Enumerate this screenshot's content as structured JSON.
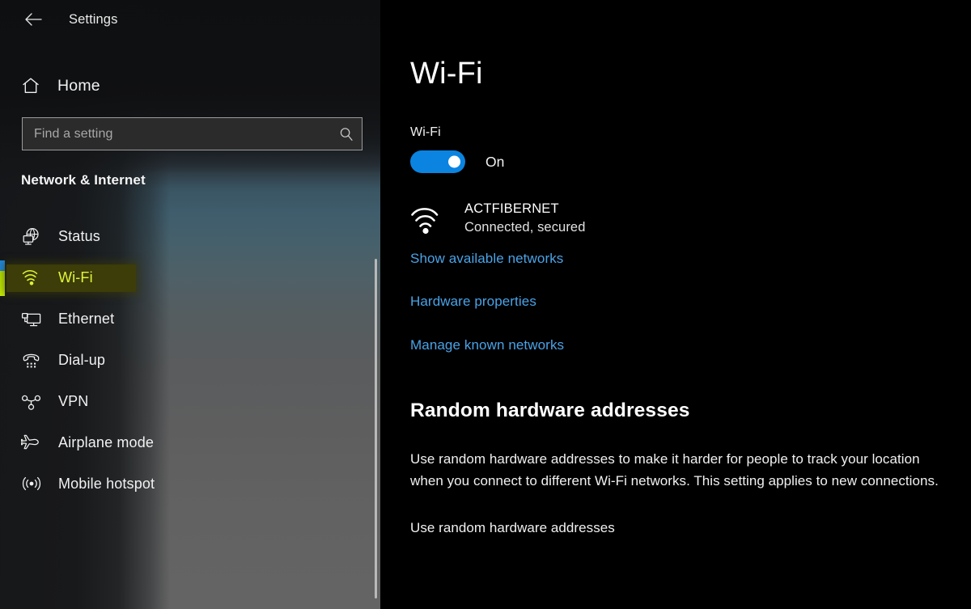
{
  "sidebar": {
    "back_label": "Back",
    "title": "Settings",
    "home": {
      "label": "Home",
      "icon": "home-icon"
    },
    "search": {
      "value": "",
      "placeholder": "Find a setting",
      "icon": "search-icon"
    },
    "category_title": "Network & Internet",
    "items": [
      {
        "label": "Status",
        "icon": "globe-status-icon",
        "selected": false
      },
      {
        "label": "Wi-Fi",
        "icon": "wifi-icon",
        "selected": true
      },
      {
        "label": "Ethernet",
        "icon": "ethernet-icon",
        "selected": false
      },
      {
        "label": "Dial-up",
        "icon": "dialup-phone-icon",
        "selected": false
      },
      {
        "label": "VPN",
        "icon": "vpn-icon",
        "selected": false
      },
      {
        "label": "Airplane mode",
        "icon": "airplane-icon",
        "selected": false
      },
      {
        "label": "Mobile hotspot",
        "icon": "mobile-hotspot-icon",
        "selected": false
      }
    ]
  },
  "main": {
    "page_title": "Wi-Fi",
    "wifi": {
      "label": "Wi-Fi",
      "toggle_state": "On",
      "toggle_on": true,
      "network_name": "ACTFIBERNET",
      "network_status": "Connected, secured",
      "network_icon": "wifi-signal-icon"
    },
    "links": [
      "Show available networks",
      "Hardware properties",
      "Manage known networks"
    ],
    "random_hw": {
      "title": "Random hardware addresses",
      "description": "Use random hardware addresses to make it harder for people to track your location when you connect to different Wi-Fi networks. This setting applies to new connections.",
      "sub_label": "Use random hardware addresses"
    }
  },
  "colors": {
    "accent_blue": "#0a84e0",
    "link_blue": "#4aa3e8",
    "selection_yellow": "#e2f53a",
    "accent_bar_blue": "#1e87e0",
    "accent_bar_green": "#c9f106",
    "main_bg": "#000000"
  }
}
